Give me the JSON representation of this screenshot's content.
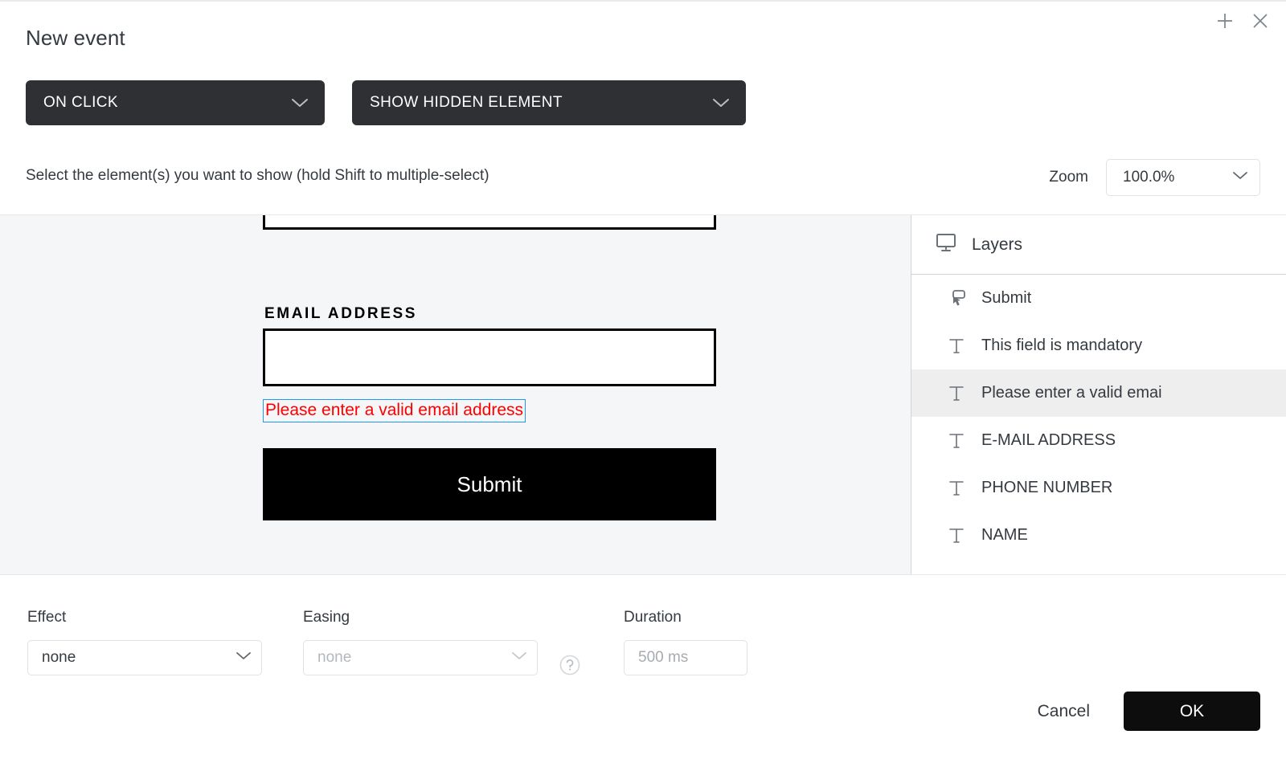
{
  "dialog": {
    "title": "New event",
    "add_icon": "plus-icon",
    "close_icon": "close-icon"
  },
  "trigger": {
    "label": "ON CLICK",
    "caret_icon": "chevron-down-icon"
  },
  "action": {
    "label": "SHOW HIDDEN ELEMENT",
    "caret_icon": "chevron-down-icon"
  },
  "instruction": "Select the element(s) you want to show (hold Shift to multiple-select)",
  "zoom": {
    "label": "Zoom",
    "value": "100.0%",
    "caret_icon": "chevron-down-icon"
  },
  "canvas": {
    "email_label": "EMAIL ADDRESS",
    "error_text": "Please enter a valid email address",
    "submit_label": "Submit",
    "selection_color": "#2196f3",
    "error_color": "#ff0000",
    "background": "#f4f6f7"
  },
  "layers": {
    "header": "Layers",
    "header_icon": "monitor-icon",
    "items": [
      {
        "label": "Submit",
        "icon": "click-button-icon",
        "selected": false
      },
      {
        "label": "This field is mandatory",
        "icon": "text-icon",
        "selected": false
      },
      {
        "label": "Please enter a valid emai",
        "icon": "text-icon",
        "selected": true
      },
      {
        "label": "E-MAIL ADDRESS",
        "icon": "text-icon",
        "selected": false
      },
      {
        "label": "PHONE NUMBER",
        "icon": "text-icon",
        "selected": false
      },
      {
        "label": "NAME",
        "icon": "text-icon",
        "selected": false
      }
    ],
    "selected_row_color": "#eeeeee"
  },
  "settings": {
    "effect": {
      "label": "Effect",
      "value": "none",
      "caret_icon": "chevron-down-icon"
    },
    "easing": {
      "label": "Easing",
      "value": "none",
      "disabled": true,
      "caret_icon": "chevron-down-icon"
    },
    "duration": {
      "label": "Duration",
      "placeholder": "500 ms",
      "value": ""
    },
    "help_icon": "question-circle-icon"
  },
  "footer": {
    "cancel_label": "Cancel",
    "ok_label": "OK"
  }
}
